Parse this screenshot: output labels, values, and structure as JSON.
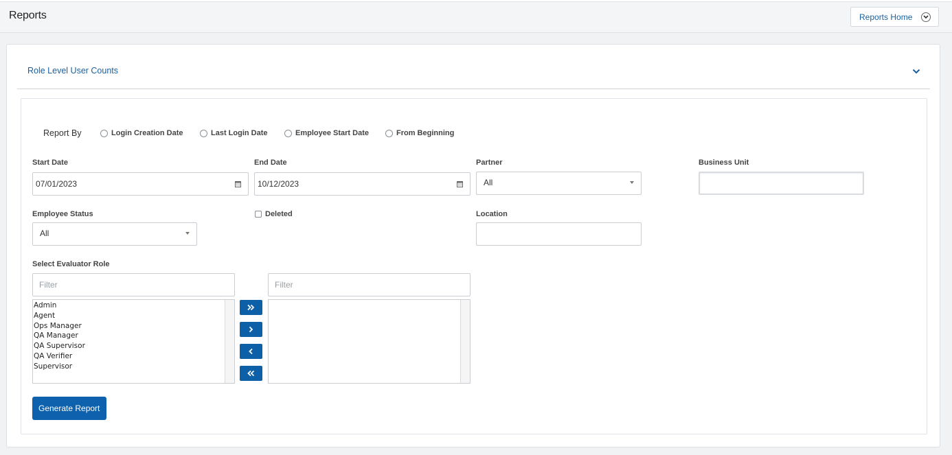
{
  "header": {
    "title": "Reports",
    "home_button": "Reports Home",
    "home_icon": "chevron-down-circle-icon"
  },
  "accordion": {
    "title": "Role Level User Counts",
    "toggle_icon": "chevron-down-icon"
  },
  "report_by": {
    "label": "Report By",
    "options": [
      "Login Creation Date",
      "Last Login Date",
      "Employee Start Date",
      "From Beginning"
    ]
  },
  "fields": {
    "start_date": {
      "label": "Start Date",
      "value": "07/01/2023",
      "icon": "calendar-icon"
    },
    "end_date": {
      "label": "End Date",
      "value": "10/12/2023",
      "icon": "calendar-icon"
    },
    "partner": {
      "label": "Partner",
      "value": "All"
    },
    "business_unit": {
      "label": "Business Unit",
      "value": ""
    },
    "employee_status": {
      "label": "Employee Status",
      "value": "All"
    },
    "deleted": {
      "label": "Deleted",
      "checked": false
    },
    "location": {
      "label": "Location",
      "value": ""
    }
  },
  "evaluator": {
    "label": "Select Evaluator Role",
    "left_filter_placeholder": "Filter",
    "right_filter_placeholder": "Filter",
    "available": [
      "Admin",
      "Agent",
      "Ops Manager",
      "QA Manager",
      "QA Supervisor",
      "QA Verifier",
      "Supervisor"
    ],
    "selected": [],
    "buttons": [
      "move-all-right-icon",
      "move-right-icon",
      "move-left-icon",
      "move-all-left-icon"
    ]
  },
  "generate_button": "Generate Report",
  "colors": {
    "primary": "#0d61ad",
    "link": "#1a5f9e",
    "background": "#f1f2f4"
  }
}
